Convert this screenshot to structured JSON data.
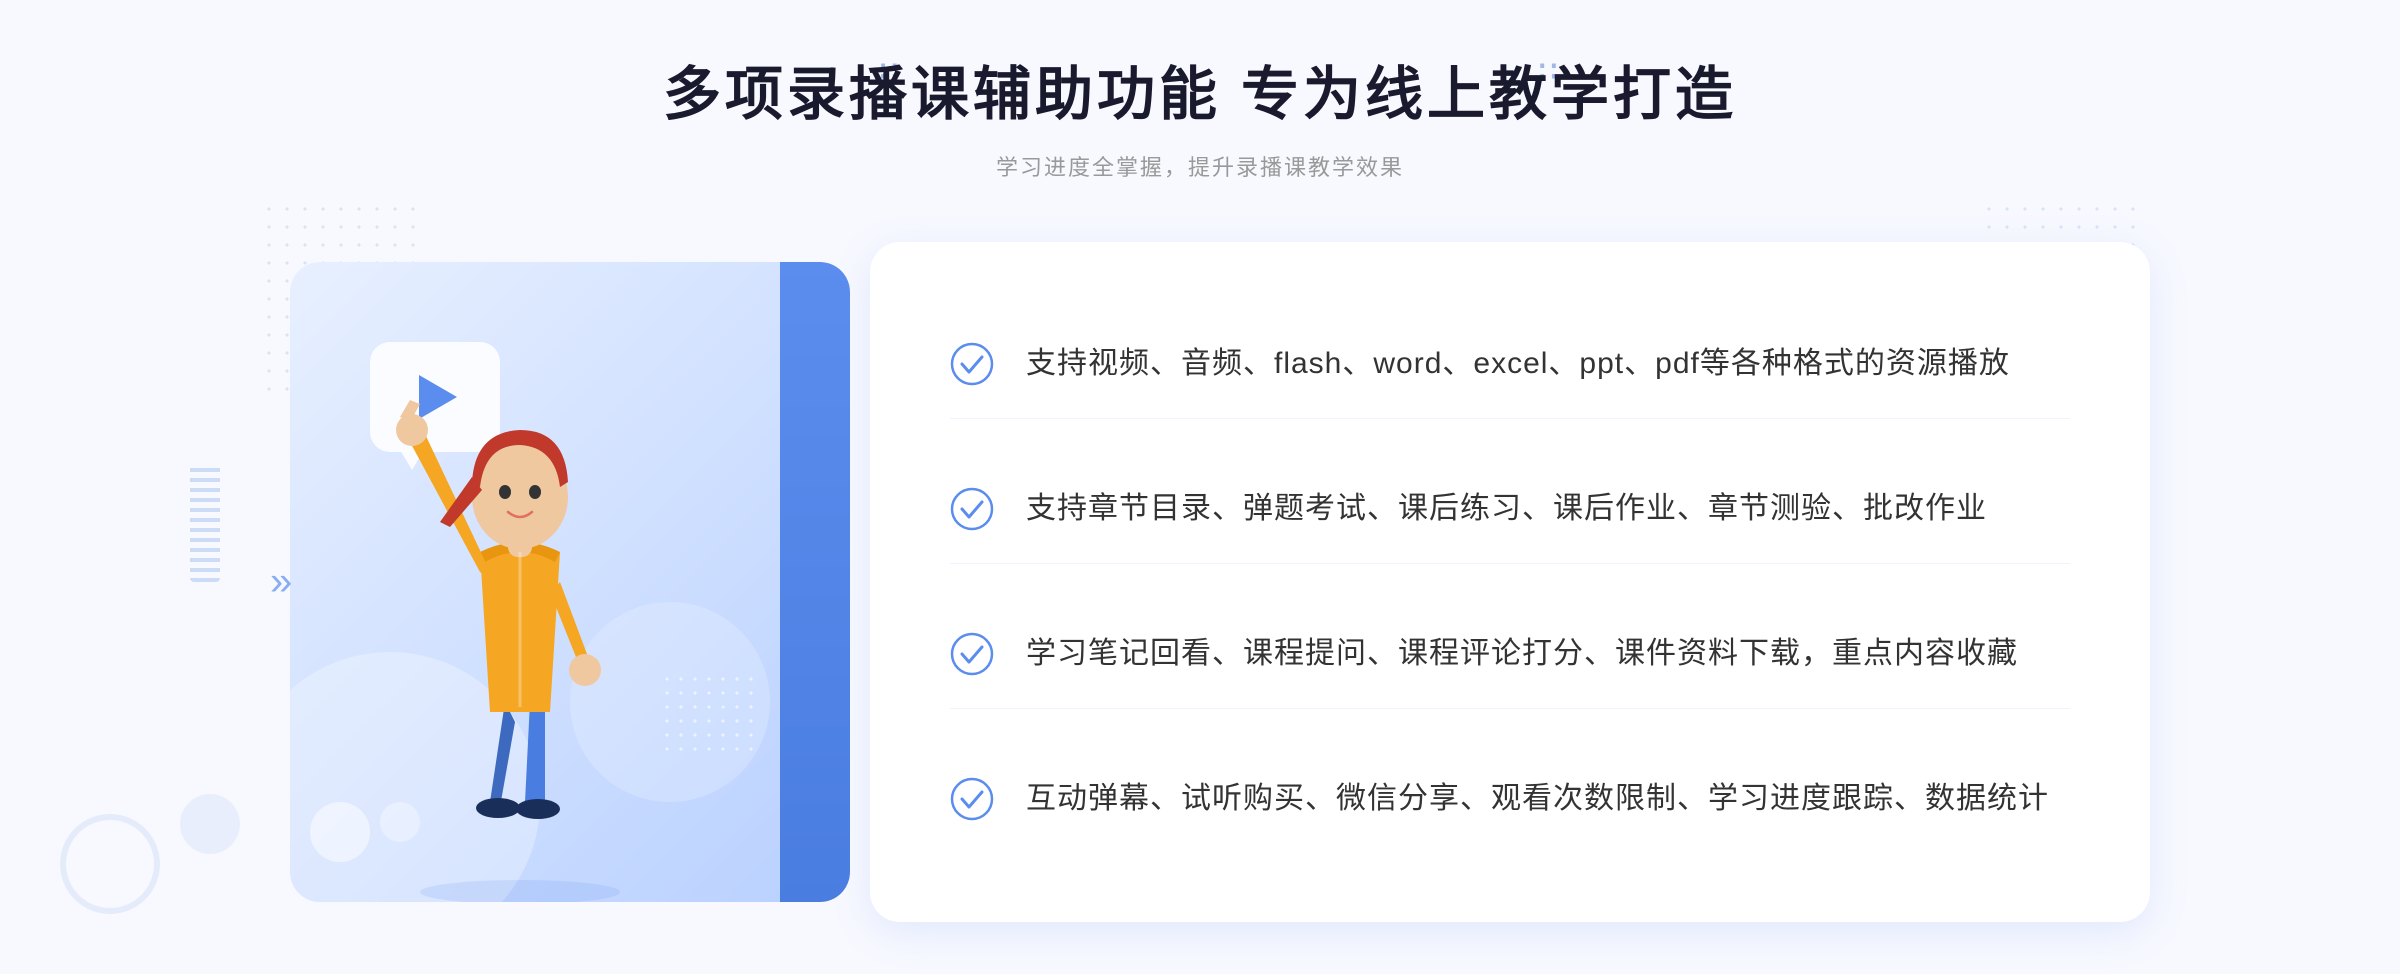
{
  "header": {
    "main_title": "多项录播课辅助功能 专为线上教学打造",
    "sub_title": "学习进度全掌握，提升录播课教学效果"
  },
  "features": [
    {
      "id": 1,
      "text": "支持视频、音频、flash、word、excel、ppt、pdf等各种格式的资源播放"
    },
    {
      "id": 2,
      "text": "支持章节目录、弹题考试、课后练习、课后作业、章节测验、批改作业"
    },
    {
      "id": 3,
      "text": "学习笔记回看、课程提问、课程评论打分、课件资料下载，重点内容收藏"
    },
    {
      "id": 4,
      "text": "互动弹幕、试听购买、微信分享、观看次数限制、学习进度跟踪、数据统计"
    }
  ],
  "decorations": {
    "left_arrow": "»",
    "grid_dots": "⠿"
  },
  "colors": {
    "primary_blue": "#5b8dee",
    "light_blue": "#e8f0ff",
    "check_blue": "#5b8dee"
  }
}
